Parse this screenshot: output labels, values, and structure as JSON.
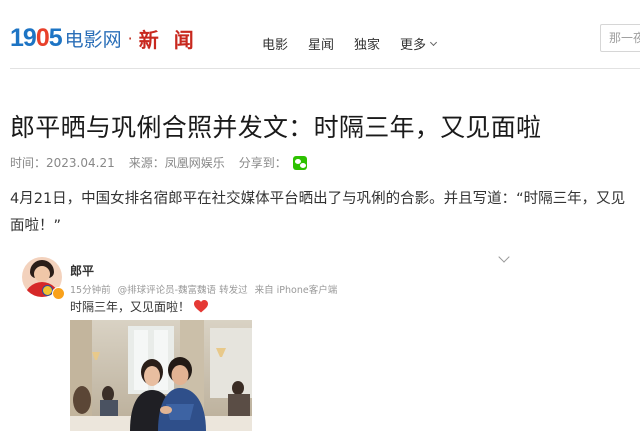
{
  "header": {
    "logo_number": "19",
    "logo_o": "0",
    "logo_tail": "5",
    "logo_site": "电影网",
    "logo_dot": "·",
    "logo_section": "新 闻",
    "nav": [
      "电影",
      "星闻",
      "独家",
      "更多"
    ],
    "search_placeholder": "那一夜"
  },
  "article": {
    "title": "郎平晒与巩俐合照并发文：时隔三年，又见面啦",
    "time_label": "时间：2023.04.21",
    "source_label": "来源：凤凰网娱乐",
    "share_label": "分享到：",
    "paragraph": "4月21日，中国女排名宿郎平在社交媒体平台晒出了与巩俐的合影。并且写道：“时隔三年，又见面啦！”"
  },
  "post": {
    "username": "郎平",
    "time": "15分钟前",
    "via": "@排球评论员-魏富魏语 转发过",
    "device": "来自 iPhone客户端",
    "text": "时隔三年，又见面啦！",
    "heart_icon": "heart-icon",
    "verified_color": "#f9a11b"
  },
  "colors": {
    "logo_blue": "#1d74c4",
    "logo_red": "#e8402a",
    "section_red": "#c8281e",
    "wechat_green": "#2dc100"
  }
}
